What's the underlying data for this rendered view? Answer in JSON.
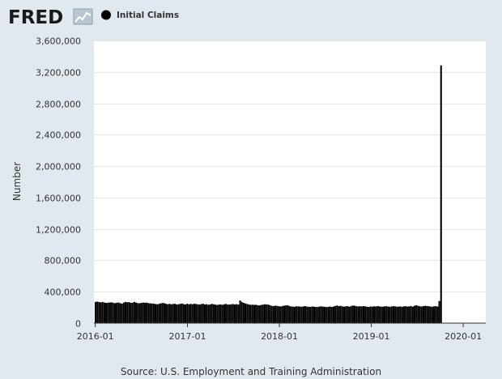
{
  "logo": {
    "text": "FRED"
  },
  "source_text": "Source: U.S. Employment and Training Administration",
  "colors": {
    "background": "#e1e9f0",
    "plot_background": "#ffffff",
    "bar": "#000000",
    "grid": "#e6e6e6"
  },
  "chart_data": {
    "type": "bar",
    "title": "",
    "legend": [
      "Initial Claims"
    ],
    "legend_placement": "top",
    "xlabel": "",
    "ylabel": "Number",
    "ylim": [
      0,
      3600000
    ],
    "yticks": [
      0,
      400000,
      800000,
      1200000,
      1600000,
      2000000,
      2400000,
      2800000,
      3200000,
      3600000
    ],
    "ytick_labels": [
      "0",
      "400,000",
      "800,000",
      "1,200,000",
      "1,600,000",
      "2,000,000",
      "2,400,000",
      "2,800,000",
      "3,200,000",
      "3,600,000"
    ],
    "xlim": [
      "2016-01-02",
      "2020-03-21"
    ],
    "xticks": [
      "2016-01-01",
      "2017-01-01",
      "2018-01-01",
      "2019-01-01",
      "2020-01-01"
    ],
    "xtick_labels": [
      "2016-01",
      "2017-01",
      "2018-01",
      "2019-01",
      "2020-01"
    ],
    "grid": true,
    "frequency": "weekly",
    "series": [
      {
        "name": "Initial Claims",
        "start": "2016-01-02",
        "values": [
          270000,
          275000,
          268000,
          265000,
          270000,
          262000,
          258000,
          260000,
          262000,
          265000,
          259000,
          254000,
          260000,
          262000,
          255000,
          248000,
          262000,
          270000,
          266000,
          268000,
          258000,
          260000,
          270000,
          262000,
          255000,
          253000,
          258000,
          262000,
          259000,
          261000,
          255000,
          252000,
          250000,
          248000,
          243000,
          240000,
          245000,
          252000,
          256000,
          254000,
          246000,
          241000,
          246000,
          240000,
          244000,
          246000,
          238000,
          240000,
          245000,
          250000,
          242000,
          238000,
          247000,
          240000,
          245000,
          241000,
          246000,
          243000,
          240000,
          236000,
          243000,
          246000,
          238000,
          241000,
          234000,
          238000,
          245000,
          240000,
          235000,
          232000,
          236000,
          238000,
          234000,
          240000,
          244000,
          237000,
          236000,
          240000,
          243000,
          238000,
          242000,
          236000,
          289000,
          270000,
          258000,
          250000,
          244000,
          238000,
          233000,
          235000,
          232000,
          234000,
          228000,
          226000,
          232000,
          235000,
          240000,
          238000,
          236000,
          228000,
          220000,
          216000,
          222000,
          220000,
          215000,
          212000,
          218000,
          222000,
          225000,
          228000,
          218000,
          212000,
          210000,
          208000,
          214000,
          212000,
          211000,
          209000,
          213000,
          216000,
          210000,
          208000,
          207000,
          212000,
          209000,
          206000,
          205000,
          210000,
          214000,
          210000,
          208000,
          205000,
          207000,
          211000,
          206000,
          212000,
          218000,
          225000,
          216000,
          220000,
          213000,
          210000,
          214000,
          216000,
          209000,
          218000,
          223000,
          221000,
          216000,
          212000,
          215000,
          213000,
          216000,
          214000,
          209000,
          206000,
          211000,
          210000,
          214000,
          212000,
          217000,
          213000,
          210000,
          209000,
          213000,
          215000,
          211000,
          208000,
          212000,
          216000,
          213000,
          209000,
          210000,
          212000,
          208000,
          213000,
          215000,
          211000,
          214000,
          216000,
          210000,
          222000,
          228000,
          220000,
          214000,
          212000,
          216000,
          220000,
          218000,
          215000,
          211000,
          208000,
          214000,
          216000,
          211000,
          282000,
          3283000
        ]
      }
    ]
  }
}
